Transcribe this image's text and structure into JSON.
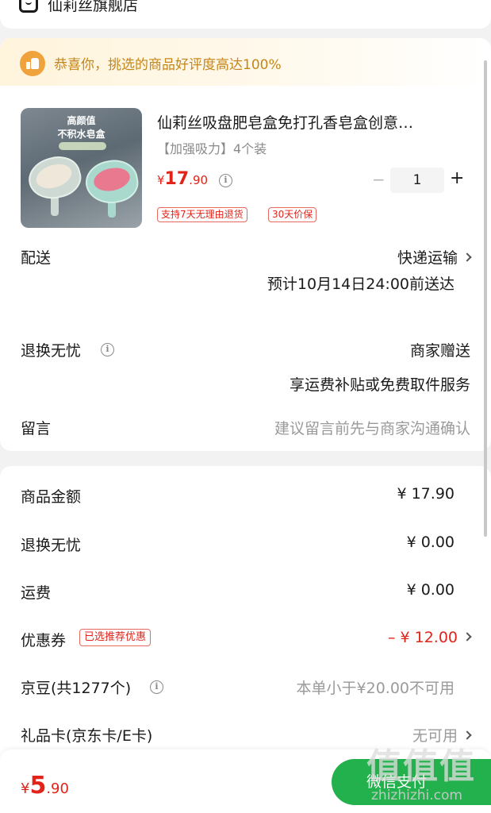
{
  "store": {
    "name": "仙莉丝旗舰店"
  },
  "banner": {
    "text": "恭喜你，挑选的商品好评度高达100%"
  },
  "product": {
    "image_text_1": "高颜值",
    "image_text_2": "不积水皂盒",
    "title": "仙莉丝吸盘肥皂盒免打孔香皂盒创意…",
    "spec": "【加强吸力】4个装",
    "price_symbol": "¥",
    "price_int": "17",
    "price_dec": ".90",
    "quantity": "1",
    "minus_label": "−",
    "plus_label": "+",
    "tags": [
      "支持7天无理由退货",
      "30天价保"
    ]
  },
  "delivery": {
    "label": "配送",
    "method": "快递运输",
    "eta": "预计10月14日24:00前送达"
  },
  "returns": {
    "label": "退换无忧",
    "value": "商家赠送",
    "detail": "享运费补贴或免费取件服务"
  },
  "message": {
    "label": "留言",
    "placeholder": "建议留言前先与商家沟通确认"
  },
  "costs": {
    "goods_label": "商品金额",
    "goods_value": "¥ 17.90",
    "returns_label": "退换无忧",
    "returns_value": "¥ 0.00",
    "shipping_label": "运费",
    "shipping_value": "¥ 0.00",
    "coupon_label": "优惠券",
    "coupon_tag": "已选推荐优惠",
    "coupon_value": "– ¥ 12.00",
    "jingdou_label": "京豆(共1277个)",
    "jingdou_value": "本单小于¥20.00不可用",
    "giftcard_label": "礼品卡(京东卡/E卡)",
    "giftcard_value": "无可用"
  },
  "footer": {
    "total_symbol": "¥",
    "total_int": "5",
    "total_dec": ".90",
    "pay_label": "微信支付",
    "watermark": "值值值",
    "watermark_url": "zhizhizhi.com"
  },
  "colors": {
    "accent_red": "#e2231a",
    "pay_green": "#22b14c",
    "banner_gold": "#c4861a"
  },
  "icons": [
    "store-icon",
    "thumb-up-icon",
    "info-icon",
    "chevron-right-icon"
  ]
}
